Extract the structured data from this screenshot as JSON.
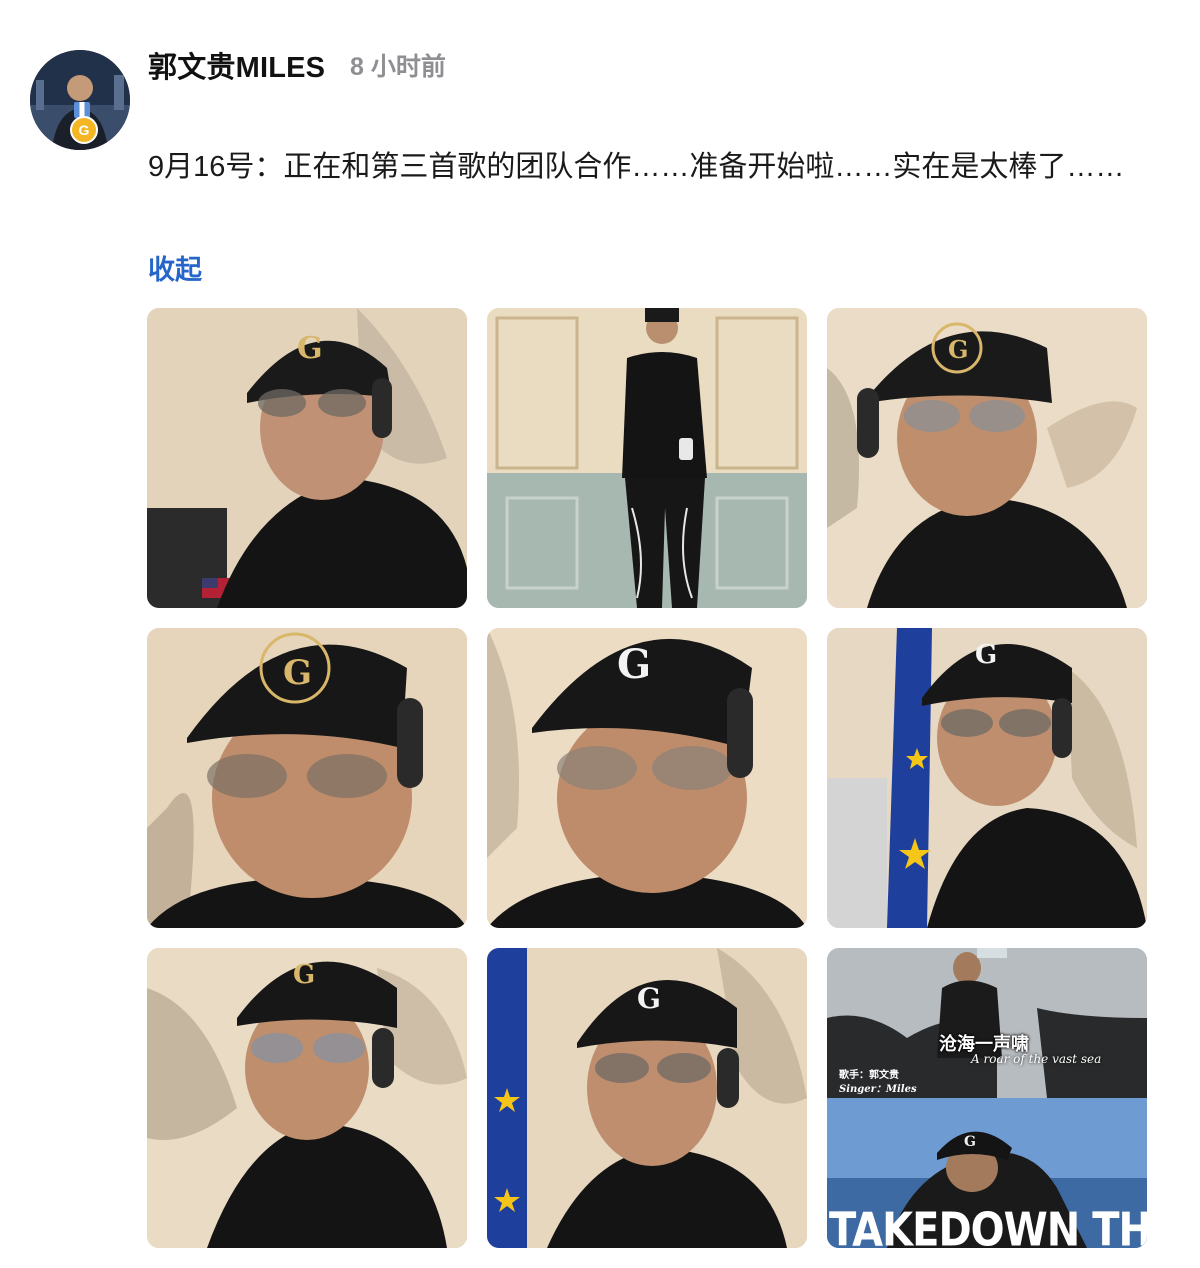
{
  "post": {
    "author": "郭文贵MILES",
    "timestamp": "8 小时前",
    "verified_badge": "G",
    "text": "9月16号：正在和第三首歌的团队合作……准备开始啦……实在是太棒了……",
    "collapse_label": "收起"
  },
  "photos": [
    {
      "scene": "selfie-cap-headphones-flag"
    },
    {
      "scene": "full-body-standing-phone"
    },
    {
      "scene": "selfie-forever-cap-butterfly"
    },
    {
      "scene": "closeup-forever-cap"
    },
    {
      "scene": "closeup-g-cap"
    },
    {
      "scene": "selfie-eu-flag"
    },
    {
      "scene": "selfie-glasses-butterfly"
    },
    {
      "scene": "selfie-eu-flag-closeup"
    },
    {
      "scene": "video-thumbnail",
      "title_cn": "沧海一声啸",
      "title_en": "A roar of the vast sea",
      "singer_cn": "歌手：郭文贵",
      "singer_en": "Singer：Miles",
      "banner": "TAKEDOWN THE CCP"
    }
  ],
  "colors": {
    "link": "#2566c8",
    "timestamp": "#8e8e93",
    "badge": "#f4b623"
  }
}
